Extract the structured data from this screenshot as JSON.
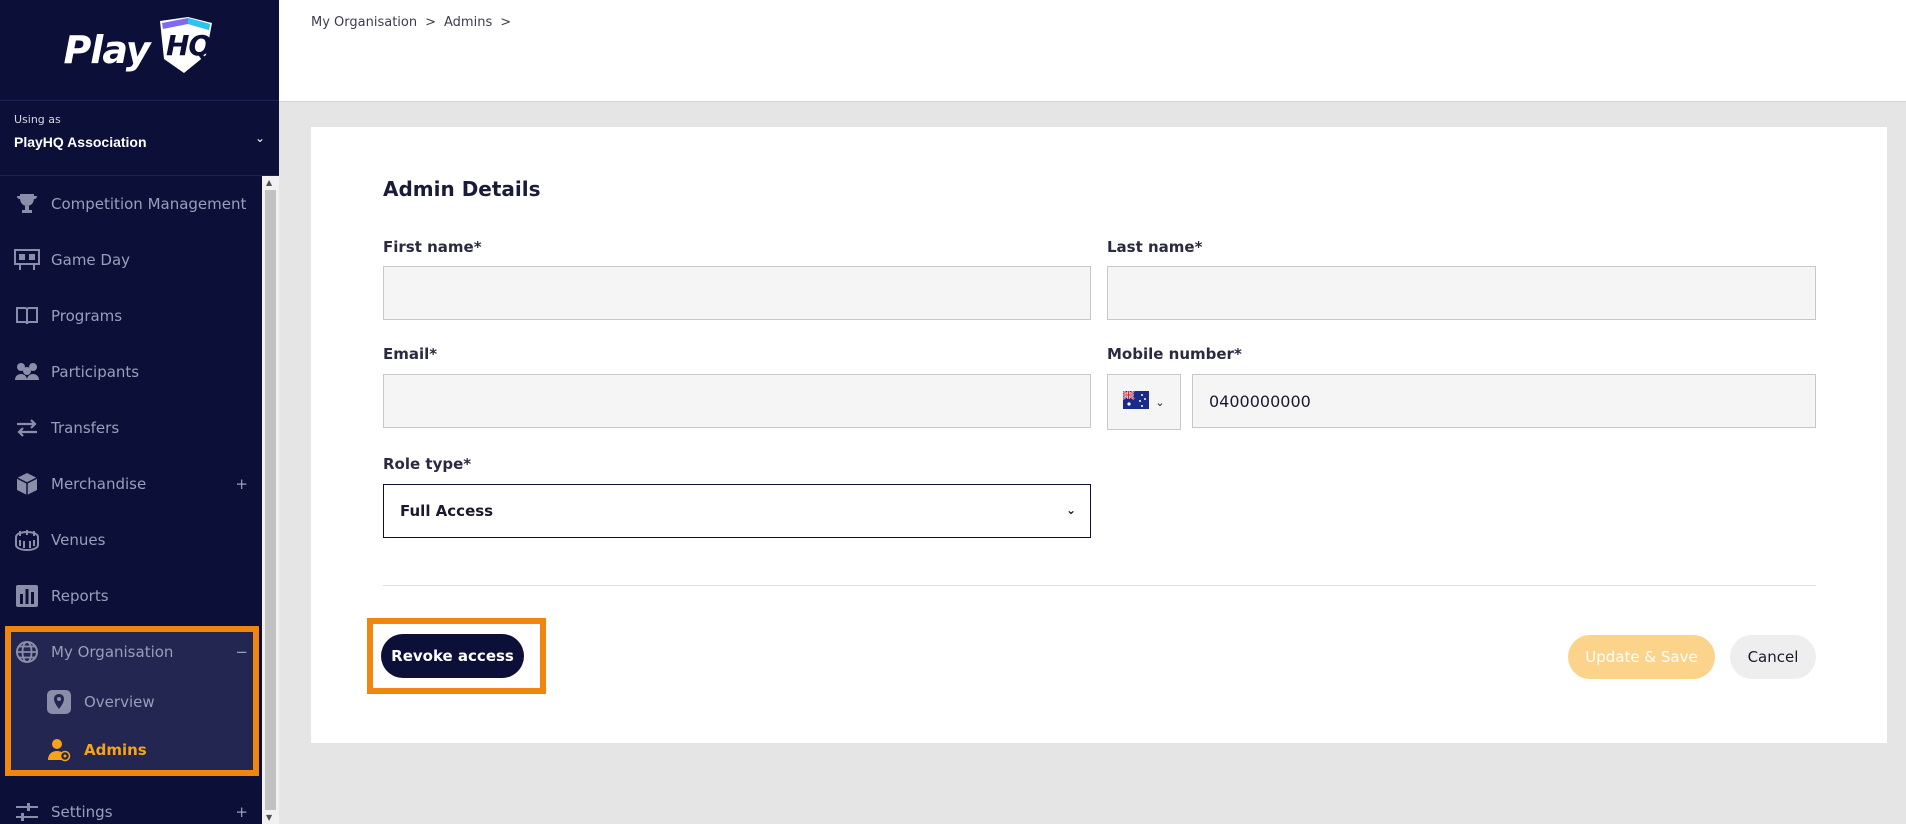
{
  "brand": {
    "logo_text": "Play",
    "logo_text_hq": "HQ"
  },
  "org_switcher": {
    "using_as": "Using as",
    "org_name": "PlayHQ Association"
  },
  "sidebar": {
    "items": [
      {
        "label": "Competition Management",
        "icon": "trophy-icon"
      },
      {
        "label": "Game Day",
        "icon": "scoreboard-icon"
      },
      {
        "label": "Programs",
        "icon": "book-icon"
      },
      {
        "label": "Participants",
        "icon": "people-icon"
      },
      {
        "label": "Transfers",
        "icon": "transfer-arrows-icon"
      },
      {
        "label": "Merchandise",
        "icon": "package-icon",
        "expander": "+"
      },
      {
        "label": "Venues",
        "icon": "stadium-icon"
      },
      {
        "label": "Reports",
        "icon": "bar-chart-icon"
      },
      {
        "label": "My Organisation",
        "icon": "globe-icon",
        "expander": "−"
      },
      {
        "label": "Settings",
        "icon": "sliders-icon",
        "expander": "+"
      }
    ],
    "sub_items": [
      {
        "label": "Overview",
        "icon": "location-pin-icon"
      },
      {
        "label": "Admins",
        "icon": "admin-user-icon",
        "active": true
      }
    ]
  },
  "breadcrumb": {
    "items": [
      "My Organisation",
      "Admins"
    ],
    "separator": ">"
  },
  "form": {
    "title": "Admin Details",
    "first_name": {
      "label": "First name*",
      "value": ""
    },
    "last_name": {
      "label": "Last name*",
      "value": ""
    },
    "email": {
      "label": "Email*",
      "value": ""
    },
    "mobile": {
      "label": "Mobile number*",
      "country": "AU",
      "value": "0400000000"
    },
    "role_type": {
      "label": "Role type*",
      "value": "Full Access"
    }
  },
  "actions": {
    "revoke": "Revoke access",
    "save": "Update & Save",
    "cancel": "Cancel"
  },
  "colors": {
    "sidebar_bg": "#0c1039",
    "accent_orange": "#f0860f",
    "active_text": "#f7a21b",
    "save_disabled": "#fbd38a"
  }
}
